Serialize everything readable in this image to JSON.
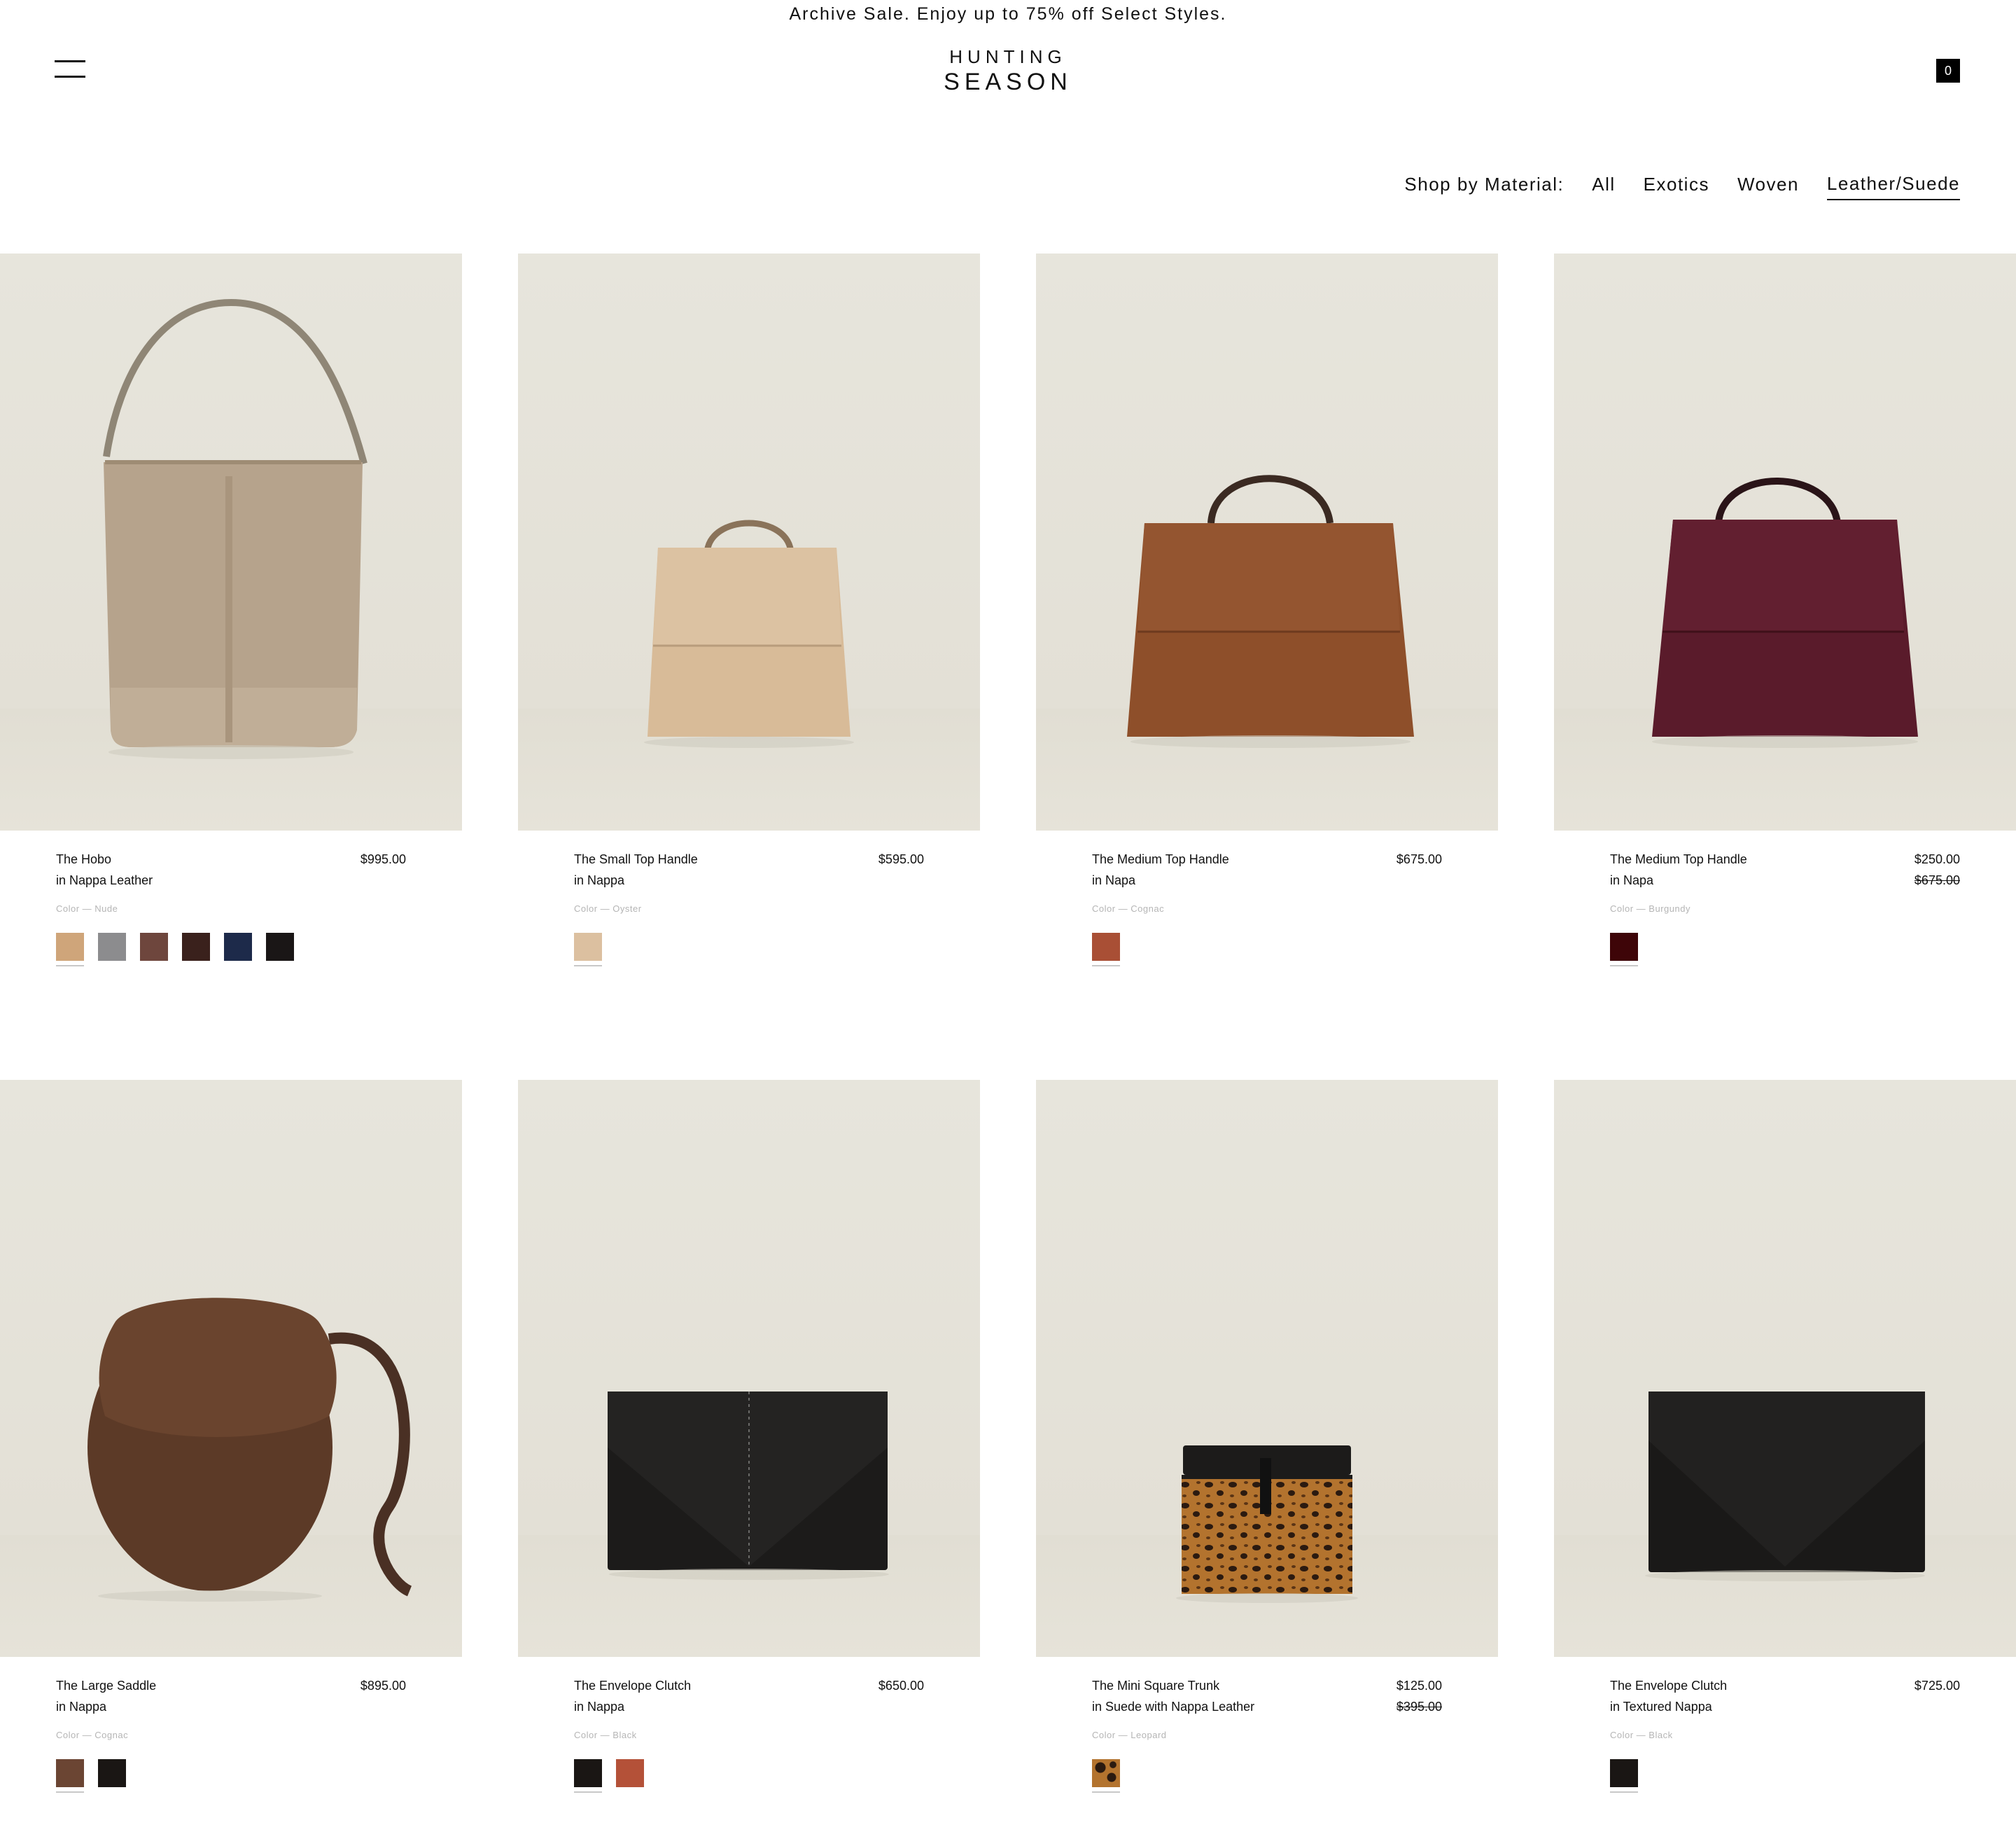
{
  "announcement": "Archive Sale. Enjoy up to 75% off Select Styles.",
  "brand": {
    "line1": "HUNTING",
    "line2": "SEASON"
  },
  "header": {
    "cart_count": "0",
    "menu_icon": "hamburger-menu-icon"
  },
  "filter": {
    "label": "Shop by Material:",
    "options": [
      "All",
      "Exotics",
      "Woven",
      "Leather/Suede"
    ],
    "active": "Leather/Suede"
  },
  "products": [
    {
      "name": "The Hobo",
      "material": "in Nappa Leather",
      "price": "$995.00",
      "original_price": "",
      "color_label": "Color — Nude",
      "swatches": [
        "#cfa57a",
        "#8c8c8e",
        "#6e463d",
        "#3a211c",
        "#1d2a4a",
        "#1a1616"
      ]
    },
    {
      "name": "The Small Top Handle",
      "material": "in Nappa",
      "price": "$595.00",
      "original_price": "",
      "color_label": "Color — Oyster",
      "swatches": [
        "#dcc0a0"
      ]
    },
    {
      "name": "The Medium Top Handle",
      "material": "in Napa",
      "price": "$675.00",
      "original_price": "",
      "color_label": "Color — Cognac",
      "swatches": [
        "#a94f35"
      ]
    },
    {
      "name": "The Medium Top Handle",
      "material": "in Napa",
      "price": "$250.00",
      "original_price": "$675.00",
      "color_label": "Color — Burgundy",
      "swatches": [
        "#3e0508"
      ]
    },
    {
      "name": "The Large Saddle",
      "material": "in Nappa",
      "price": "$895.00",
      "original_price": "",
      "color_label": "Color — Cognac",
      "swatches": [
        "#6b4533",
        "#1a1614"
      ]
    },
    {
      "name": "The Envelope Clutch",
      "material": "in Nappa",
      "price": "$650.00",
      "original_price": "",
      "color_label": "Color — Black",
      "swatches": [
        "#1a1614",
        "#b45138"
      ]
    },
    {
      "name": "The Mini Square Trunk",
      "material": "in Suede with Nappa Leather",
      "price": "$125.00",
      "original_price": "$395.00",
      "color_label": "Color — Leopard",
      "swatches": [
        "leopard"
      ]
    },
    {
      "name": "The Envelope Clutch",
      "material": "in Textured Nappa",
      "price": "$725.00",
      "original_price": "",
      "color_label": "Color — Black",
      "swatches": [
        "#1a1614"
      ]
    }
  ]
}
